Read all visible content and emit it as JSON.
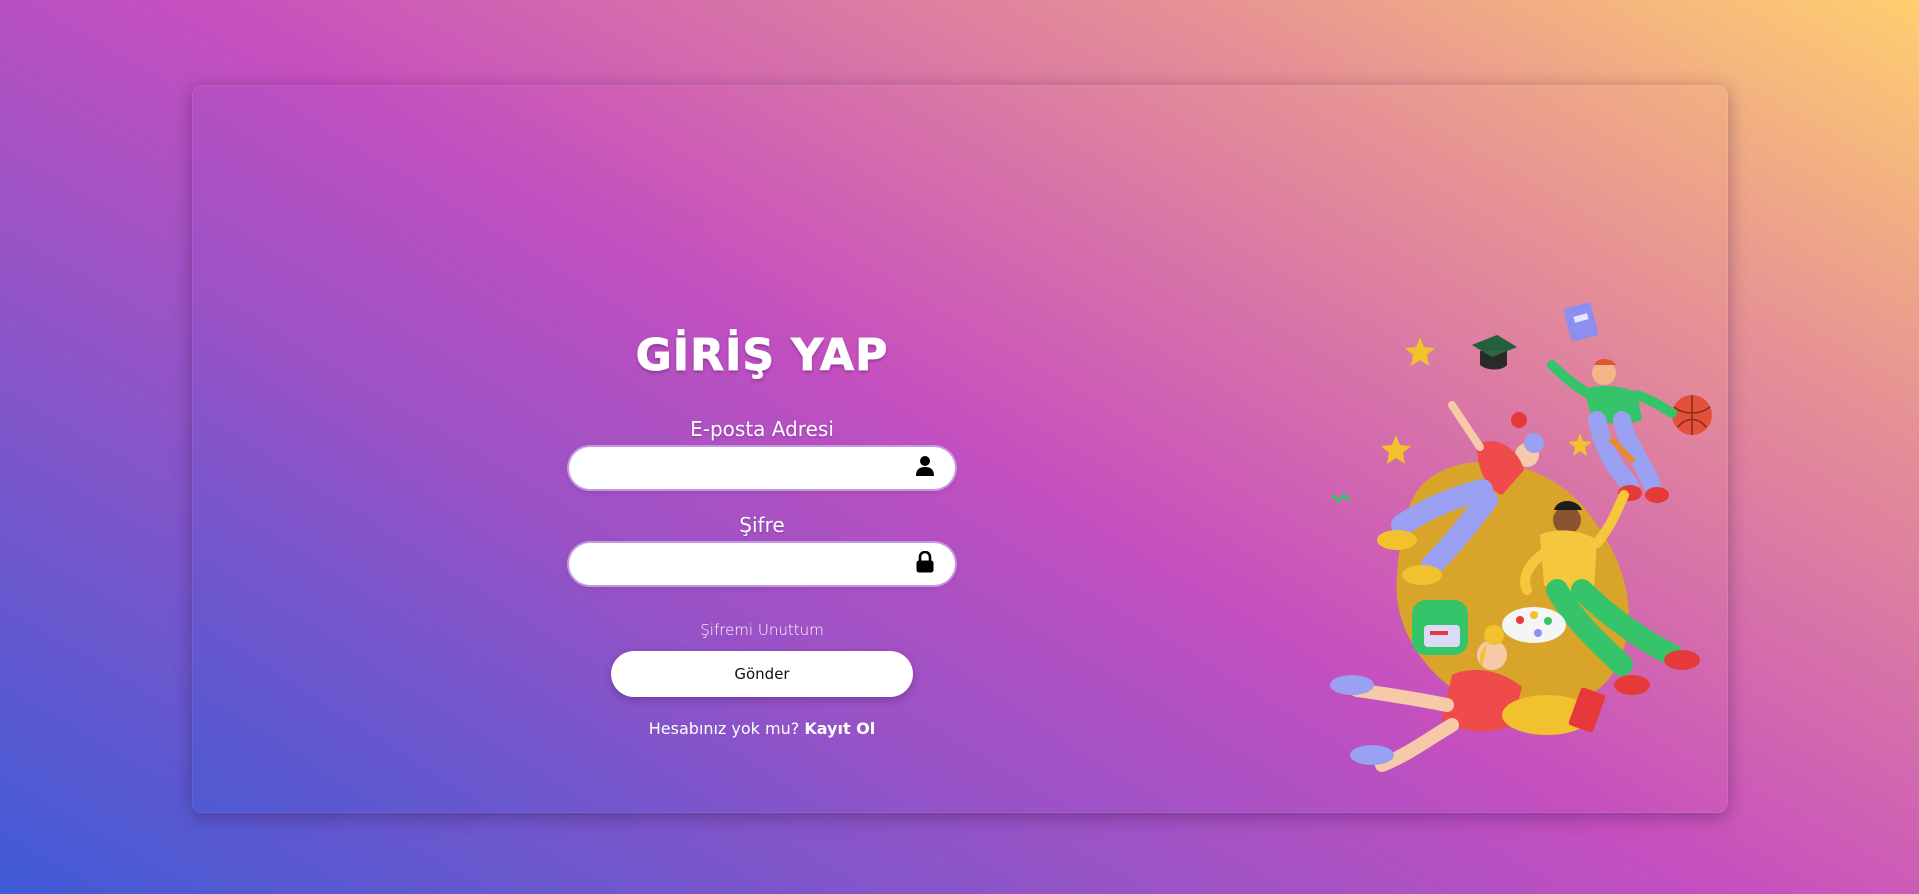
{
  "login": {
    "title": "GİRİŞ YAP",
    "email_label": "E-posta Adresi",
    "email_value": "",
    "email_icon": "user-icon",
    "password_label": "Şifre",
    "password_value": "",
    "password_icon": "lock-icon",
    "forgot_link": "Şifremi Unuttum",
    "submit_label": "Gönder",
    "signup_prompt": "Hesabınız yok mu?",
    "signup_link": "Kayıt Ol"
  },
  "illustration": {
    "name": "students-3d-illustration"
  },
  "colors": {
    "gradient_start": "#3f5bd6",
    "gradient_mid": "#c64fbf",
    "gradient_end": "#ffcf6f",
    "field_bg": "#ffffff",
    "text": "#ffffff"
  }
}
